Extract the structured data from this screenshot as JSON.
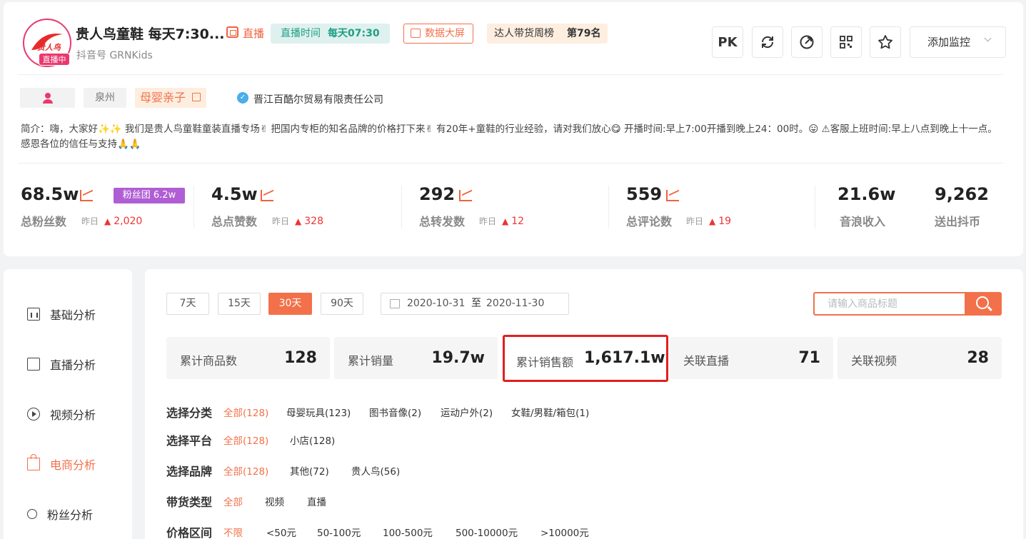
{
  "profile": {
    "title": "贵人鸟童鞋 每天7:30...",
    "live_badge": "直播中",
    "live_tag": "直播",
    "avatar_logo_text": "贵人鸟",
    "douyin_id": "抖音号 GRNKids",
    "broadcast_time_label": "直播时间",
    "broadcast_time_value": "每天07:30",
    "data_screen_label": "数据大屏",
    "rank_label": "达人带货周榜",
    "rank_value": "第79名"
  },
  "toolbar": {
    "pk_label": "PK",
    "monitor_label": "添加监控"
  },
  "tags": {
    "city": "泉州",
    "category": "母婴亲子",
    "company": "晋江百酷尔贸易有限责任公司"
  },
  "intro": "简介：嗨，大家好✨✨ 我们是贵人鸟童鞋童装直播专场✌ 把国内专柜的知名品牌的价格打下来✌ 有20年+童鞋的行业经验，请对我们放心😋 开播时间:早上7:00开播到晚上24：00时。😛 ⚠客服上班时间:早上八点到晚上十一点。 感恩各位的信任与支持🙏🙏",
  "stats": {
    "fans": {
      "value": "68.5w",
      "label": "总粉丝数",
      "yday_label": "昨日",
      "yday_value": "2,020"
    },
    "fans_club": "粉丝团 6.2w",
    "likes": {
      "value": "4.5w",
      "label": "总点赞数",
      "yday_label": "昨日",
      "yday_value": "328"
    },
    "shares": {
      "value": "292",
      "label": "总转发数",
      "yday_label": "昨日",
      "yday_value": "12"
    },
    "comments": {
      "value": "559",
      "label": "总评论数",
      "yday_label": "昨日",
      "yday_value": "19"
    },
    "sound_wave": {
      "value": "21.6w",
      "label": "音浪收入"
    },
    "coins": {
      "value": "9,262",
      "label": "送出抖币"
    }
  },
  "sidebar": {
    "items": [
      {
        "label": "基础分析"
      },
      {
        "label": "直播分析"
      },
      {
        "label": "视频分析"
      },
      {
        "label": "电商分析"
      },
      {
        "label": "粉丝分析"
      }
    ]
  },
  "periods": [
    "7天",
    "15天",
    "30天",
    "90天"
  ],
  "date_range": {
    "start": "2020-10-31",
    "to": "至",
    "end": "2020-11-30"
  },
  "search": {
    "placeholder": "请输入商品标题"
  },
  "metrics": [
    {
      "label": "累计商品数",
      "value": "128"
    },
    {
      "label": "累计销量",
      "value": "19.7w"
    },
    {
      "label": "累计销售额",
      "value": "1,617.1w"
    },
    {
      "label": "关联直播",
      "value": "71"
    },
    {
      "label": "关联视频",
      "value": "28"
    }
  ],
  "filters": {
    "category": {
      "title": "选择分类",
      "options": [
        "全部(128)",
        "母婴玩具(123)",
        "图书音像(2)",
        "运动户外(2)",
        "女鞋/男鞋/箱包(1)"
      ]
    },
    "platform": {
      "title": "选择平台",
      "options": [
        "全部(128)",
        "小店(128)"
      ]
    },
    "brand": {
      "title": "选择品牌",
      "options": [
        "全部(128)",
        "其他(72)",
        "贵人鸟(56)"
      ]
    },
    "type": {
      "title": "带货类型",
      "options": [
        "全部",
        "视频",
        "直播"
      ]
    },
    "price": {
      "title": "价格区间",
      "options": [
        "不限",
        "<50元",
        "50-100元",
        "100-500元",
        "500-10000元",
        ">10000元"
      ]
    }
  }
}
